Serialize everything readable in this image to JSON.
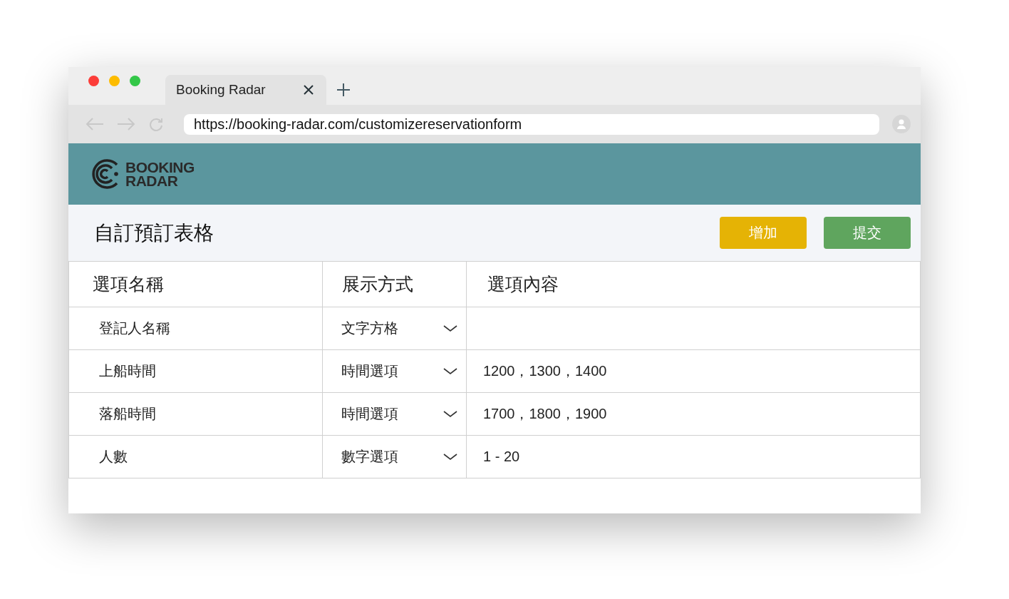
{
  "browser": {
    "tab": {
      "title": "Booking Radar"
    },
    "url": "https://booking-radar.com/customizereservationform"
  },
  "logo": {
    "line_1": "BOOKING",
    "line_2": "RADAR"
  },
  "page": {
    "title": "自訂預訂表格",
    "buttons": [
      {
        "label": "增加",
        "kind": "add"
      },
      {
        "label": "提交",
        "kind": "submit"
      }
    ]
  },
  "table": {
    "columns": [
      "選項名稱",
      "展示方式",
      "選項內容"
    ],
    "rows": [
      {
        "name": "登記人名稱",
        "display": "文字方格",
        "content": ""
      },
      {
        "name": "上船時間",
        "display": "時間選項",
        "content": "1200，1300，1400"
      },
      {
        "name": "落船時間",
        "display": "時間選項",
        "content": "1700，1800，1900"
      },
      {
        "name": "人數",
        "display": "數字選項",
        "content": "1 - 20"
      }
    ]
  }
}
